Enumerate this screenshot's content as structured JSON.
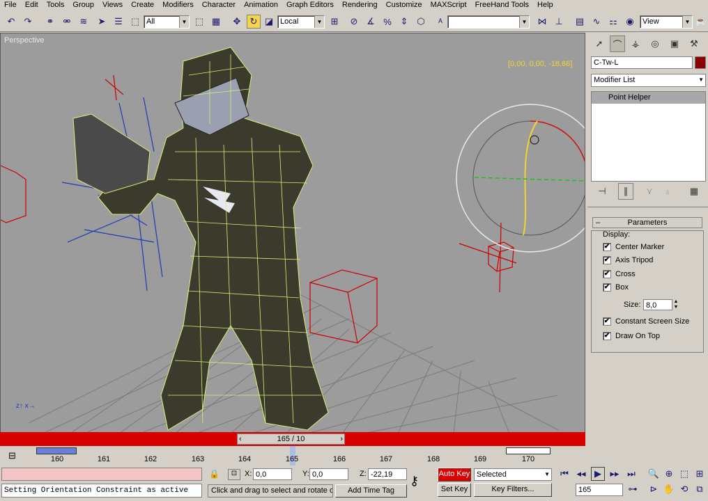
{
  "menu": [
    "File",
    "Edit",
    "Tools",
    "Group",
    "Views",
    "Create",
    "Modifiers",
    "Character",
    "Animation",
    "Graph Editors",
    "Rendering",
    "Customize",
    "MAXScript",
    "FreeHand Tools",
    "Help"
  ],
  "toolbar": {
    "selection_filter": "All",
    "reference_coord": "Local",
    "view_dropdown": "View",
    "named_selection": ""
  },
  "viewport": {
    "label": "Perspective",
    "gizmo_coords": "[0,00, 0,00, -18,66]"
  },
  "command_panel": {
    "object_name": "C-Tw-L",
    "object_color": "#8b0000",
    "modifier_list_label": "Modifier List",
    "stack_item": "Point Helper",
    "rollout_title": "Parameters",
    "display_label": "Display:",
    "checks": [
      {
        "label": "Center Marker",
        "checked": true
      },
      {
        "label": "Axis Tripod",
        "checked": true
      },
      {
        "label": "Cross",
        "checked": true
      },
      {
        "label": "Box",
        "checked": true
      }
    ],
    "size_label": "Size:",
    "size_value": "8,0",
    "checks2": [
      {
        "label": "Constant Screen Size",
        "checked": true
      },
      {
        "label": "Draw On Top",
        "checked": true
      }
    ]
  },
  "timeline": {
    "slider_text": "165 / 10",
    "ticks": [
      "160",
      "161",
      "162",
      "163",
      "164",
      "165",
      "166",
      "167",
      "168",
      "169",
      "170"
    ]
  },
  "status": {
    "maxscript_output": "Setting Orientation Constraint as active",
    "prompt": "Click and drag to select and rotate ol",
    "add_time_tag": "Add Time Tag",
    "x_label": "X:",
    "x_value": "0,0",
    "y_label": "Y:",
    "y_value": "0,0",
    "z_label": "Z:",
    "z_value": "-22,19",
    "auto_key": "Auto Key",
    "set_key": "Set Key",
    "key_mode": "Selected",
    "key_filters": "Key Filters...",
    "frame": "165"
  },
  "colors": {
    "accent_red": "#d90000",
    "gizmo_yellow": "#f2d431",
    "active_tool": "#f4d34d"
  }
}
